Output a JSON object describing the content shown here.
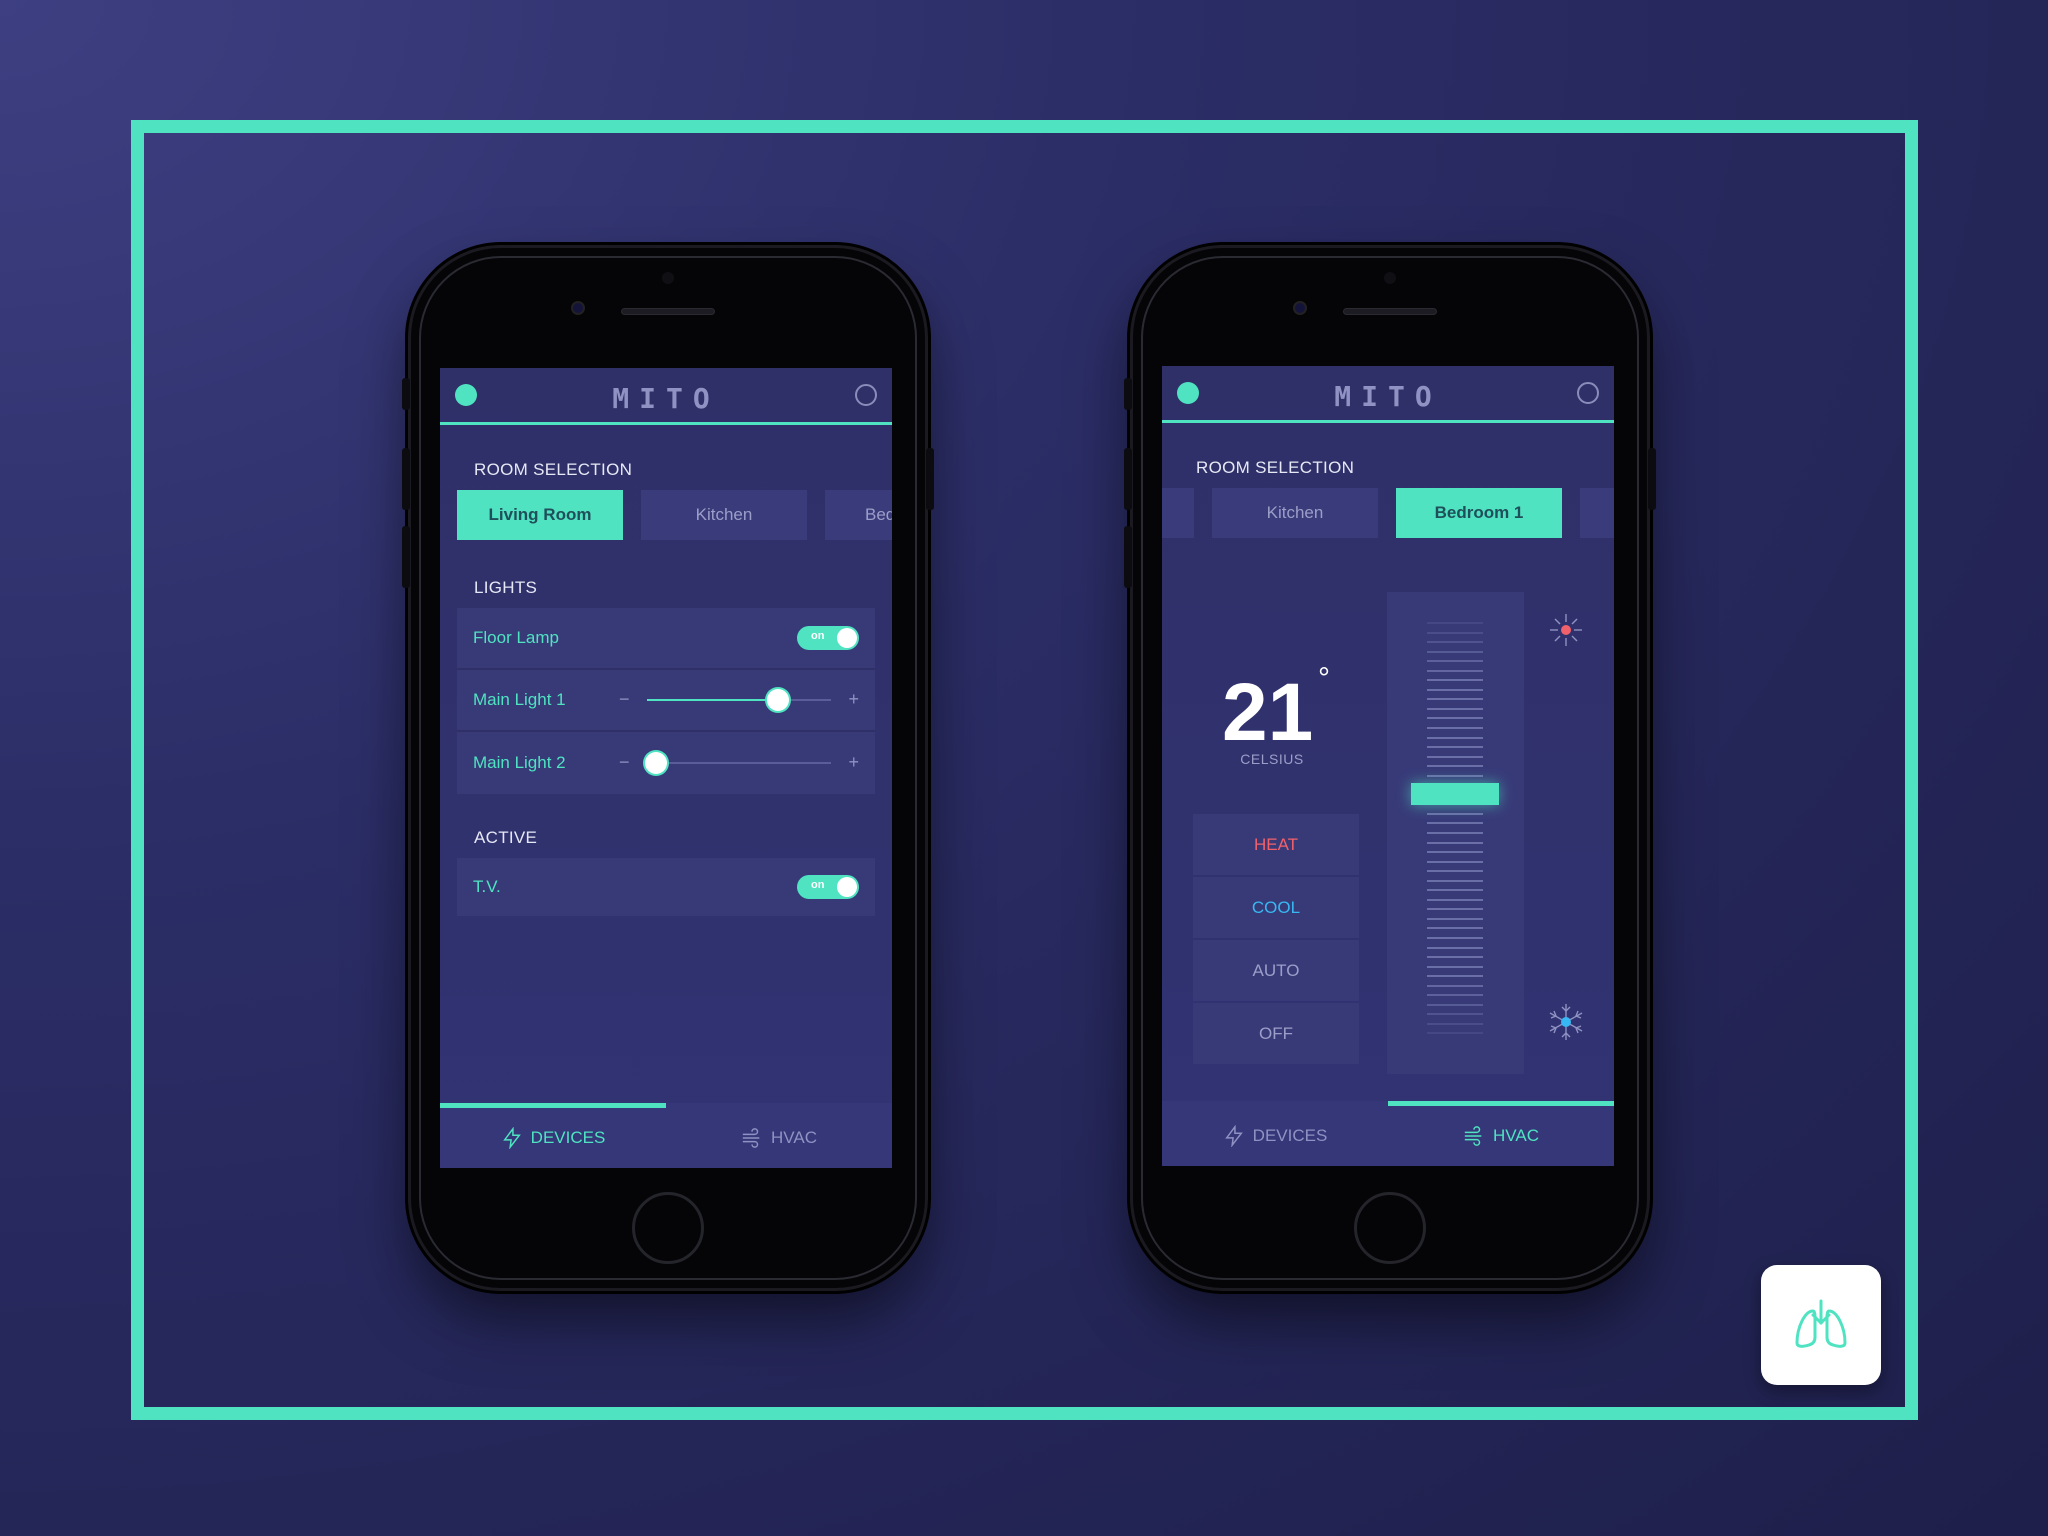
{
  "colors": {
    "accent": "#4fe3c1",
    "heat": "#f0616b",
    "cool": "#38b8f2",
    "muted": "#9c9ec9"
  },
  "devices_screen": {
    "brand": "MITO",
    "room_selection_title": "ROOM SELECTION",
    "rooms": [
      {
        "label": "Living Room",
        "active": true
      },
      {
        "label": "Kitchen",
        "active": false
      },
      {
        "label": "Bed",
        "active": false
      }
    ],
    "lights_title": "LIGHTS",
    "lights": [
      {
        "label": "Floor Lamp",
        "type": "toggle",
        "state": "on"
      },
      {
        "label": "Main Light 1",
        "type": "slider",
        "level": 0.71,
        "minus": "−",
        "plus": "+"
      },
      {
        "label": "Main Light 2",
        "type": "slider",
        "level": 0.05,
        "minus": "−",
        "plus": "+"
      }
    ],
    "active_title": "ACTIVE",
    "active": [
      {
        "label": "T.V.",
        "type": "toggle",
        "state": "on"
      }
    ],
    "tabs": [
      {
        "label": "DEVICES",
        "icon": "lightning-icon",
        "active": true
      },
      {
        "label": "HVAC",
        "icon": "wind-icon",
        "active": false
      }
    ]
  },
  "hvac_screen": {
    "brand": "MITO",
    "room_selection_title": "ROOM SELECTION",
    "rooms": [
      {
        "label": "",
        "active": false
      },
      {
        "label": "Kitchen",
        "active": false
      },
      {
        "label": "Bedroom 1",
        "active": true
      },
      {
        "label": "",
        "active": false
      }
    ],
    "temperature": "21",
    "degree_symbol": "°",
    "unit": "CELSIUS",
    "modes": [
      {
        "label": "HEAT",
        "color": "#f0616b"
      },
      {
        "label": "COOL",
        "color": "#38b8f2"
      },
      {
        "label": "AUTO",
        "color": "#9c9ec9"
      },
      {
        "label": "OFF",
        "color": "#9c9ec9"
      }
    ],
    "thermostat_level": 0.6,
    "hot_icon": "sun-icon",
    "cold_icon": "snowflake-icon",
    "tabs": [
      {
        "label": "DEVICES",
        "icon": "lightning-icon",
        "active": false
      },
      {
        "label": "HVAC",
        "icon": "wind-icon",
        "active": true
      }
    ]
  },
  "badge": {
    "icon": "lungs-icon"
  }
}
